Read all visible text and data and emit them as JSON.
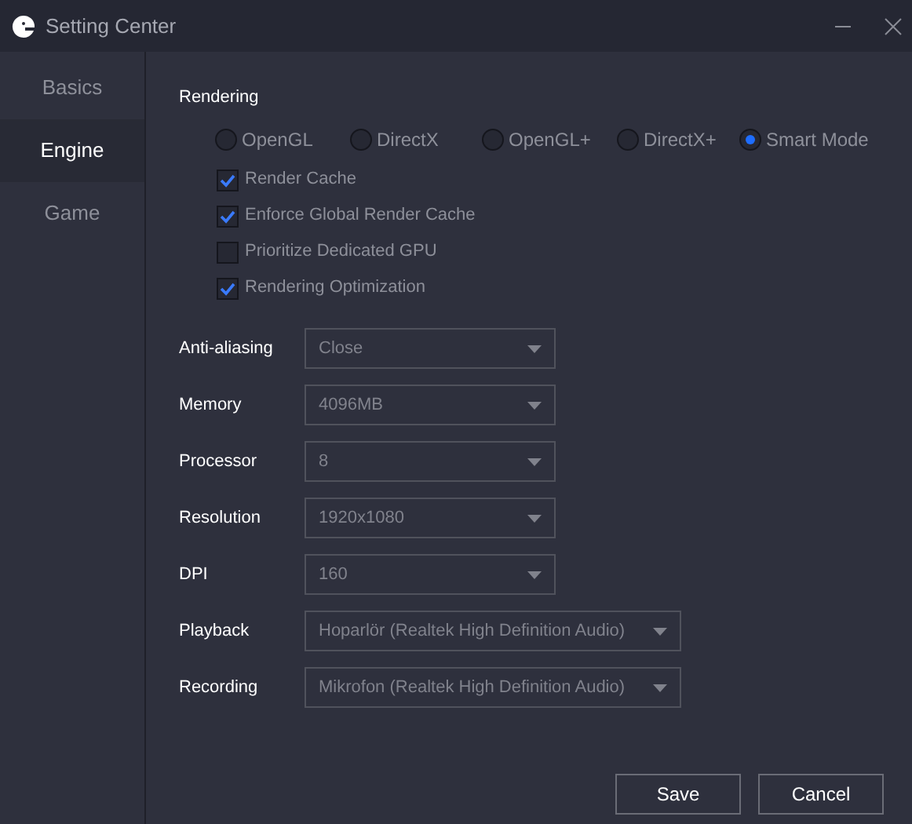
{
  "window": {
    "title": "Setting Center"
  },
  "sidebar": {
    "items": [
      {
        "label": "Basics",
        "selected": false
      },
      {
        "label": "Engine",
        "selected": true
      },
      {
        "label": "Game",
        "selected": false
      }
    ]
  },
  "rendering": {
    "title": "Rendering",
    "modes": [
      {
        "label": "OpenGL",
        "selected": false
      },
      {
        "label": "DirectX",
        "selected": false
      },
      {
        "label": "OpenGL+",
        "selected": false
      },
      {
        "label": "DirectX+",
        "selected": false
      },
      {
        "label": "Smart Mode",
        "selected": true
      }
    ],
    "options": [
      {
        "label": "Render Cache",
        "checked": true
      },
      {
        "label": "Enforce Global Render Cache",
        "checked": true
      },
      {
        "label": "Prioritize Dedicated GPU",
        "checked": false
      },
      {
        "label": "Rendering Optimization",
        "checked": true
      }
    ]
  },
  "settings": [
    {
      "label": "Anti-aliasing",
      "value": "Close",
      "wide": false
    },
    {
      "label": "Memory",
      "value": "4096MB",
      "wide": false
    },
    {
      "label": "Processor",
      "value": "8",
      "wide": false
    },
    {
      "label": "Resolution",
      "value": "1920x1080",
      "wide": false
    },
    {
      "label": "DPI",
      "value": "160",
      "wide": false
    },
    {
      "label": "Playback",
      "value": "Hoparlör (Realtek High Definition Audio)",
      "wide": true
    },
    {
      "label": "Recording",
      "value": "Mikrofon (Realtek High Definition Audio)",
      "wide": true
    }
  ],
  "buttons": [
    "Save",
    "Cancel"
  ]
}
